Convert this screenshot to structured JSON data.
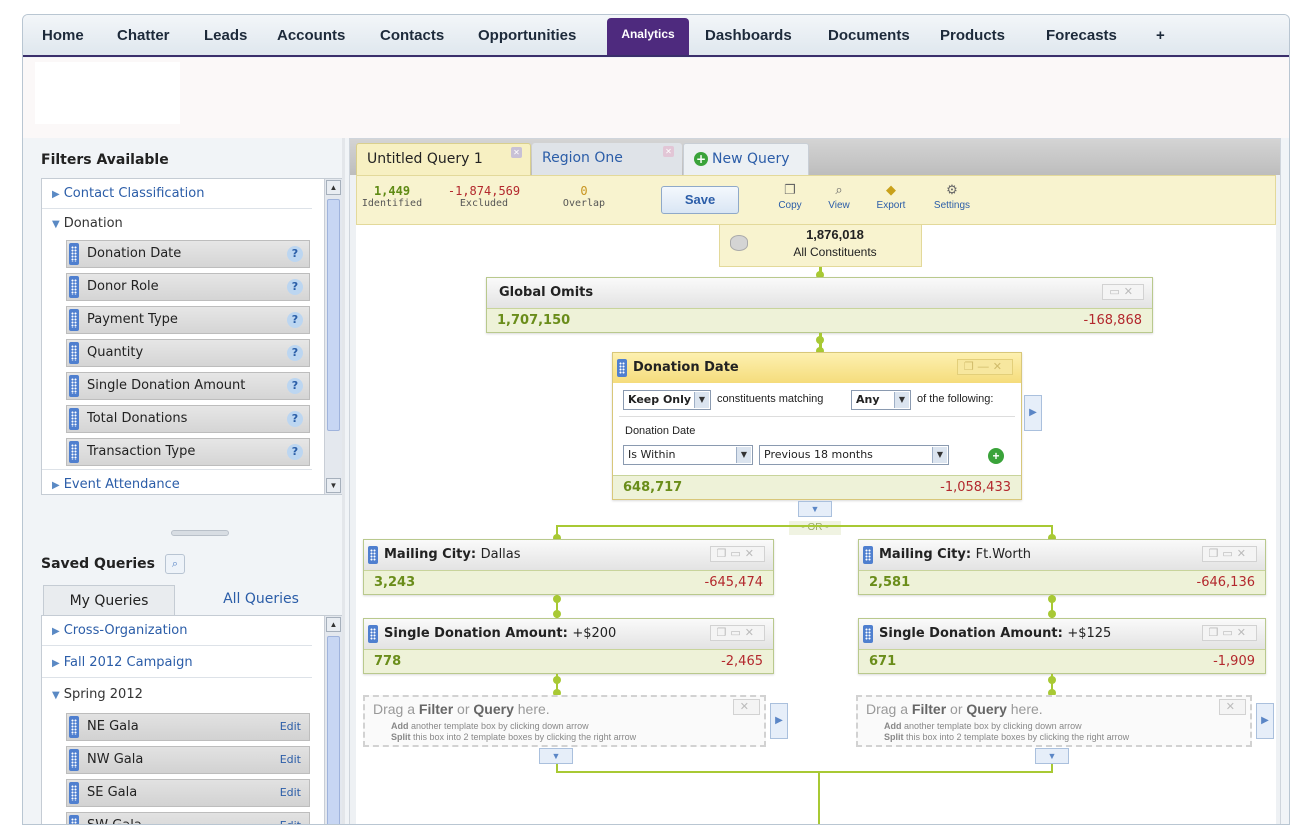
{
  "nav": {
    "items": [
      "Home",
      "Chatter",
      "Leads",
      "Accounts",
      "Contacts",
      "Opportunities",
      "Analytics",
      "Dashboards",
      "Documents",
      "Products",
      "Forecasts",
      "+"
    ],
    "active": "Analytics"
  },
  "filters": {
    "title": "Filters Available",
    "groups": [
      "Contact Classification",
      "Donation",
      "Event Attendance"
    ],
    "donation_items": [
      "Donation Date",
      "Donor Role",
      "Payment Type",
      "Quantity",
      "Single Donation Amount",
      "Total Donations",
      "Transaction Type"
    ],
    "help": "?"
  },
  "saved": {
    "title": "Saved Queries",
    "tabs": [
      "My Queries",
      "All Queries"
    ],
    "groups": [
      "Cross-Organization",
      "Fall 2012 Campaign",
      "Spring 2012"
    ],
    "items": [
      "NE Gala",
      "NW Gala",
      "SE Gala",
      "SW Gala"
    ],
    "edit_label": "Edit"
  },
  "query_tabs": [
    "Untitled Query 1",
    "Region One",
    "New Query"
  ],
  "stats": {
    "identified_value": "1,449",
    "identified_label": "Identified",
    "excluded_value": "-1,874,569",
    "excluded_label": "Excluded",
    "overlap_value": "0",
    "overlap_label": "Overlap"
  },
  "toolbar": {
    "save": "Save",
    "copy": "Copy",
    "view": "View",
    "export": "Export",
    "settings": "Settings"
  },
  "root": {
    "count": "1,876,018",
    "label": "All Constituents"
  },
  "global_omits": {
    "title": "Global Omits",
    "kept": "1,707,150",
    "removed": "-168,868"
  },
  "donation_date": {
    "title": "Donation Date",
    "mode": "Keep Only",
    "matching_text": "constituents matching",
    "any": "Any",
    "of_following": "of the following:",
    "field_label": "Donation Date",
    "operator": "Is Within",
    "value": "Previous 18 months",
    "kept": "648,717",
    "removed": "-1,058,433"
  },
  "or_label": "- OR -",
  "left_branch": {
    "city_label": "Mailing City:",
    "city_value": "Dallas",
    "city_kept": "3,243",
    "city_removed": "-645,474",
    "amt_label": "Single Donation Amount:",
    "amt_value": "+$200",
    "amt_kept": "778",
    "amt_removed": "-2,465"
  },
  "right_branch": {
    "city_label": "Mailing City:",
    "city_value": "Ft.Worth",
    "city_kept": "2,581",
    "city_removed": "-646,136",
    "amt_label": "Single Donation Amount:",
    "amt_value": "+$125",
    "amt_kept": "671",
    "amt_removed": "-1,909"
  },
  "drop": {
    "drag": "Drag a",
    "filter": "Filter",
    "or": "or",
    "query": "Query",
    "here": "here.",
    "add": "Add",
    "add_text": "another template box by clicking down arrow",
    "split": "Split",
    "split_text": "this box into 2 template boxes by clicking the right arrow"
  },
  "colors": {
    "nav_active": "#4e2a7e",
    "positive": "#6a8d1a",
    "negative": "#b3282d",
    "connector": "#a8c934"
  }
}
